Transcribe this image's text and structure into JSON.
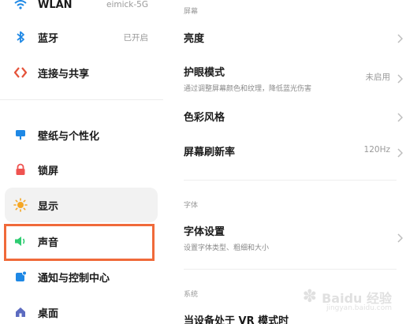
{
  "sidebar": {
    "items": [
      {
        "label": "WLAN",
        "value": "eimick-5G",
        "icon": "wifi-icon"
      },
      {
        "label": "蓝牙",
        "value": "已开启",
        "icon": "bluetooth-icon"
      },
      {
        "label": "连接与共享",
        "value": "",
        "icon": "share-icon"
      },
      {
        "label": "壁纸与个性化",
        "value": "",
        "icon": "wallpaper-icon"
      },
      {
        "label": "锁屏",
        "value": "",
        "icon": "lock-icon"
      },
      {
        "label": "显示",
        "value": "",
        "icon": "sun-icon"
      },
      {
        "label": "声音",
        "value": "",
        "icon": "speaker-icon"
      },
      {
        "label": "通知与控制中心",
        "value": "",
        "icon": "notification-icon"
      },
      {
        "label": "桌面",
        "value": "",
        "icon": "home-icon"
      }
    ]
  },
  "main": {
    "sections": [
      {
        "header": "屏幕",
        "items": [
          {
            "title": "亮度",
            "subtitle": "",
            "value": ""
          },
          {
            "title": "护眼模式",
            "subtitle": "通过调整屏幕颜色和纹理，降低蓝光伤害",
            "value": "未启用"
          },
          {
            "title": "色彩风格",
            "subtitle": "",
            "value": ""
          },
          {
            "title": "屏幕刷新率",
            "subtitle": "",
            "value": "120Hz"
          }
        ]
      },
      {
        "header": "字体",
        "items": [
          {
            "title": "字体设置",
            "subtitle": "设置字体类型、粗细和大小",
            "value": ""
          }
        ]
      },
      {
        "header": "系统",
        "items": [
          {
            "title": "当设备处于 VR 模式时",
            "subtitle": "",
            "value": ""
          }
        ]
      }
    ]
  },
  "watermark": {
    "text": "Baidu 经验",
    "sub": "jingyan.baidu.com"
  },
  "colors": {
    "highlight_border": "#f06a3a",
    "accent_blue": "#1e88e5"
  }
}
